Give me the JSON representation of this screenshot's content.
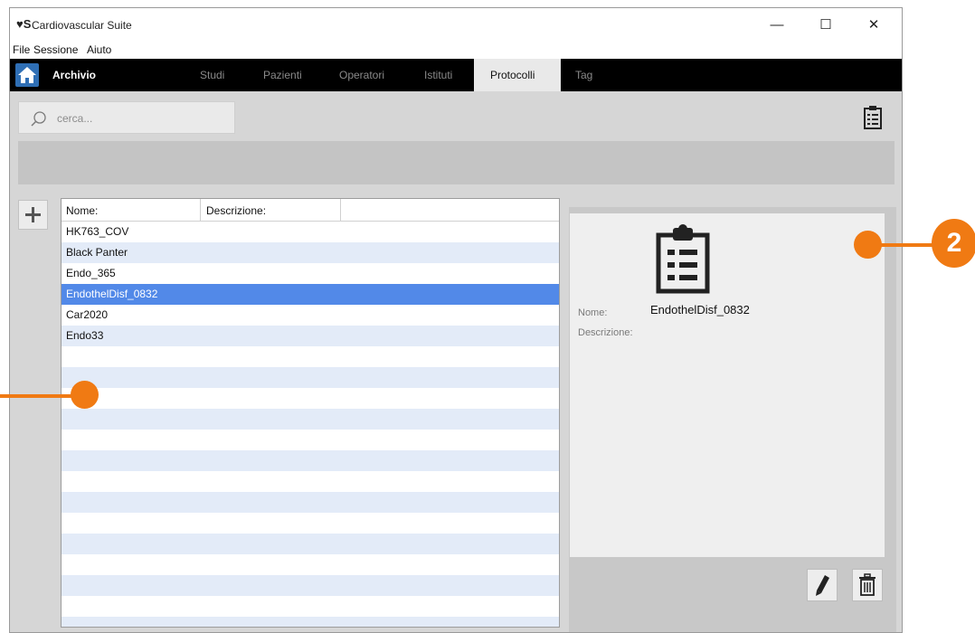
{
  "window": {
    "app_logo": "♥S",
    "title": "Cardiovascular Suite",
    "controls": {
      "minimize": "—",
      "maximize": "☐",
      "close": "✕"
    }
  },
  "menu": [
    "File",
    "Sessione",
    "Aiuto"
  ],
  "nav": {
    "home": "Archivio",
    "tabs": [
      {
        "label": "Studi",
        "active": false
      },
      {
        "label": "Pazienti",
        "active": false
      },
      {
        "label": "Operatori",
        "active": false
      },
      {
        "label": "Istituti",
        "active": false
      },
      {
        "label": "Protocolli",
        "active": true
      },
      {
        "label": "Tag",
        "active": false
      }
    ]
  },
  "search": {
    "placeholder": "cerca...",
    "value": ""
  },
  "list": {
    "columns": [
      "Nome:",
      "Descrizione:"
    ],
    "rows": [
      "HK763_COV",
      "Black Panter",
      "Endo_365",
      "EndothelDisf_0832",
      "Car2020",
      "Endo33"
    ],
    "selected_index": 3
  },
  "detail": {
    "name_label": "Nome:",
    "name_value": "EndothelDisf_0832",
    "description_label": "Descrizione:",
    "description_value": ""
  },
  "callouts": {
    "badge_number": "2"
  },
  "colors": {
    "accent_blue": "#5289e8",
    "callout_orange": "#f07a13",
    "navbar_bg": "#000000",
    "home_button": "#2f6fb5"
  }
}
